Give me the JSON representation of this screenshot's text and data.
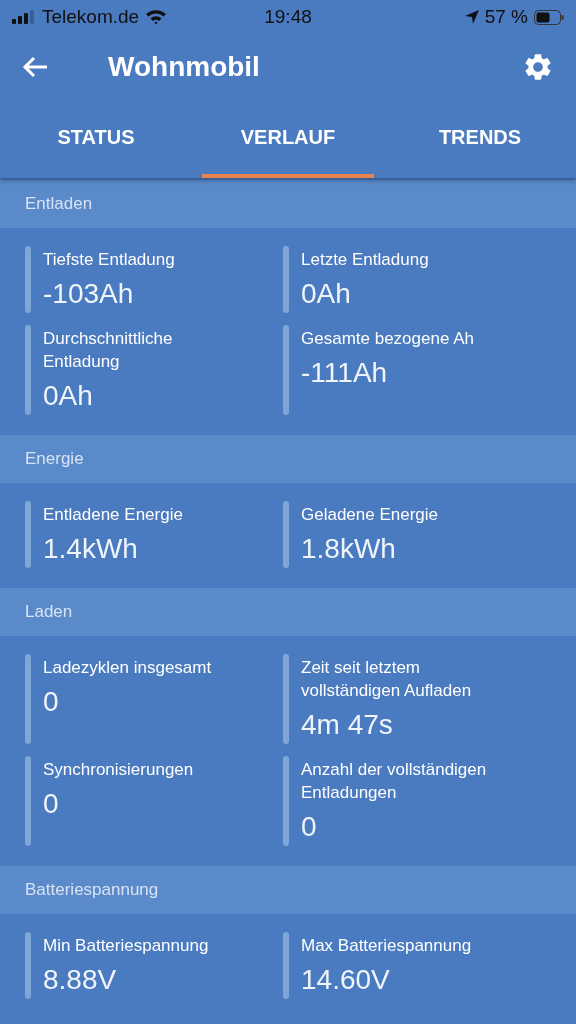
{
  "status_bar": {
    "carrier": "Telekom.de",
    "time": "19:48",
    "battery": "57 %"
  },
  "app_bar": {
    "title": "Wohnmobil"
  },
  "tabs": [
    {
      "label": "STATUS",
      "selected": false
    },
    {
      "label": "VERLAUF",
      "selected": true
    },
    {
      "label": "TRENDS",
      "selected": false
    }
  ],
  "sections": [
    {
      "title": "Entladen",
      "items": [
        {
          "label": "Tiefste Entladung",
          "value": "-103Ah"
        },
        {
          "label": "Letzte Entladung",
          "value": "0Ah"
        },
        {
          "label": "Durchschnittliche Entladung",
          "value": "0Ah"
        },
        {
          "label": "Gesamte bezogene Ah",
          "value": "-111Ah"
        }
      ]
    },
    {
      "title": "Energie",
      "items": [
        {
          "label": "Entladene Energie",
          "value": "1.4kWh"
        },
        {
          "label": "Geladene Energie",
          "value": "1.8kWh"
        }
      ]
    },
    {
      "title": "Laden",
      "items": [
        {
          "label": "Ladezyklen insgesamt",
          "value": "0"
        },
        {
          "label": "Zeit seit letztem vollständigen Aufladen",
          "value": "4m 47s"
        },
        {
          "label": "Synchronisierungen",
          "value": "0"
        },
        {
          "label": "Anzahl der vollständigen Entladungen",
          "value": "0"
        }
      ]
    },
    {
      "title": "Batteriespannung",
      "items": [
        {
          "label": "Min Batteriespannung",
          "value": "8.88V"
        },
        {
          "label": "Max Batteriespannung",
          "value": "14.60V"
        }
      ]
    }
  ]
}
